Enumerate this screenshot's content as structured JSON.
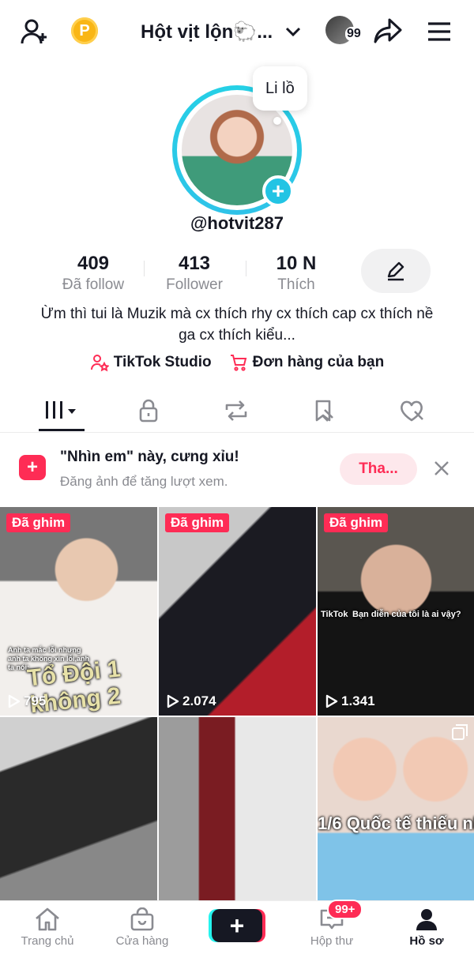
{
  "header": {
    "title": "Hột vịt lộn🐑...",
    "friends_badge": "99"
  },
  "profile": {
    "note": "Li lồ",
    "username": "@hotvit287",
    "stats": [
      {
        "value": "409",
        "label": "Đã follow"
      },
      {
        "value": "413",
        "label": "Follower"
      },
      {
        "value": "10 N",
        "label": "Thích"
      }
    ],
    "bio": "Ừm thì tui là Muzik mà cx thích rhy cx thích cap cx thích nề ga cx thích kiểu...",
    "links": [
      {
        "label": "TikTok Studio",
        "icon": "person-star-icon"
      },
      {
        "label": "Đơn hàng của bạn",
        "icon": "cart-icon"
      }
    ]
  },
  "tabs": [
    {
      "name": "videos",
      "icon": "grid-bars-icon",
      "active": true
    },
    {
      "name": "private",
      "icon": "lock-icon"
    },
    {
      "name": "reposts",
      "icon": "repost-icon"
    },
    {
      "name": "favorites",
      "icon": "bookmark-icon"
    },
    {
      "name": "liked",
      "icon": "heart-icon"
    }
  ],
  "banner": {
    "title": "\"Nhìn em\" này, cưng xỉu!",
    "subtitle": "Đăng ảnh để tăng lượt xem.",
    "button": "Tha..."
  },
  "videos": [
    {
      "pinned": "Đã ghim",
      "views": "795",
      "caption": "Anh ta mắc lỗi nhưng anh ta không xin lỗi,anh ta nói:",
      "overlay": "Tổ Đội 1 không 2"
    },
    {
      "pinned": "Đã ghim",
      "views": "2.074"
    },
    {
      "pinned": "Đã ghim",
      "views": "1.341",
      "watermark": "TikTok",
      "overlay": "Bạn diễn của tôi là ai vậy?"
    },
    {},
    {},
    {
      "overlay": "1/6 Quốc tế thiếu nhi❌"
    }
  ],
  "bottom_nav": [
    {
      "label": "Trang chủ",
      "icon": "home-icon"
    },
    {
      "label": "Cửa hàng",
      "icon": "shop-icon"
    },
    {
      "label": "",
      "icon": "plus-icon"
    },
    {
      "label": "Hộp thư",
      "icon": "inbox-icon",
      "badge": "99+"
    },
    {
      "label": "Hồ sơ",
      "icon": "profile-icon",
      "active": true
    }
  ],
  "colors": {
    "accent": "#fe2c55",
    "ring": "#22c4e4",
    "coin": "#f9b616",
    "text": "#161823",
    "muted": "#8a8b91"
  }
}
